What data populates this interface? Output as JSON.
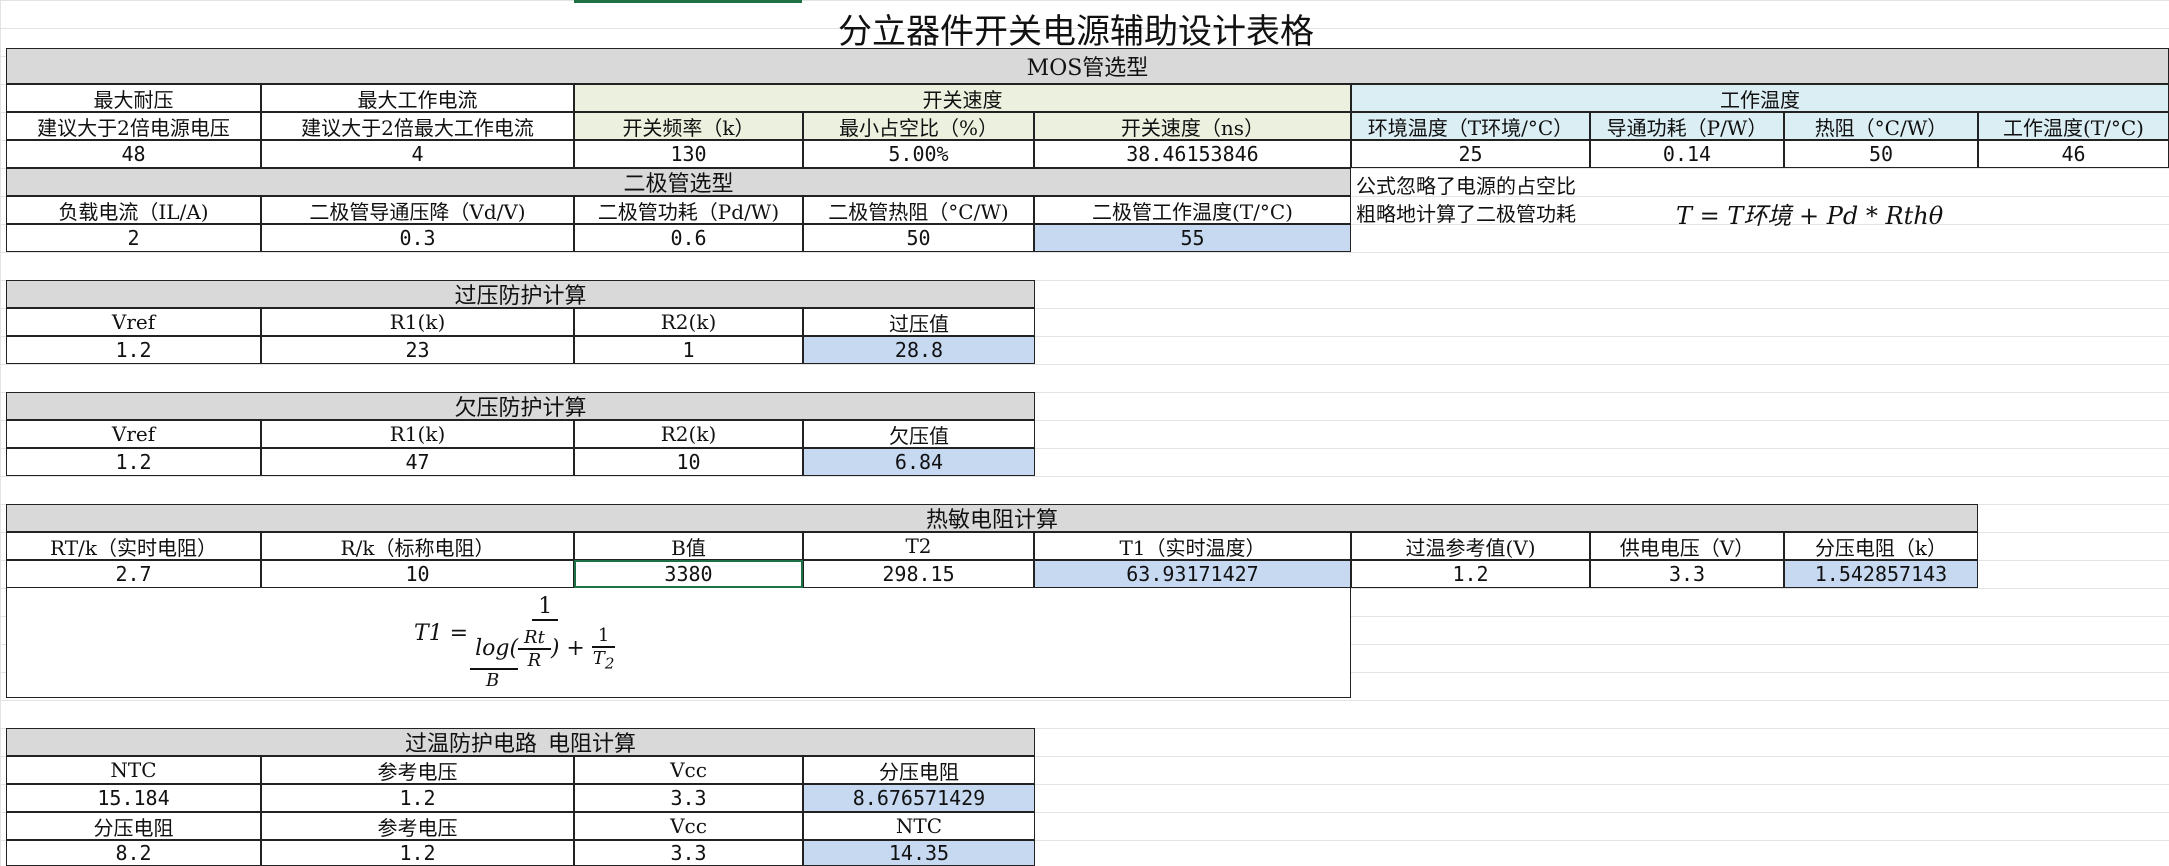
{
  "title": "分立器件开关电源辅助设计表格",
  "mos": {
    "section": "MOS管选型",
    "max_voltage": "最大耐压",
    "max_current": "最大工作电流",
    "switch_speed": "开关速度",
    "work_temp": "工作温度",
    "h_voltage": "建议大于2倍电源电压",
    "h_current": "建议大于2倍最大工作电流",
    "h_freq": "开关频率（k）",
    "h_duty": "最小占空比（%）",
    "h_speed": "开关速度（ns）",
    "h_env": "环境温度（T环境/°C）",
    "h_power": "导通功耗（P/W）",
    "h_thermal": "热阻（°C/W）",
    "h_wtemp": "工作温度(T/°C)",
    "values": [
      "48",
      "4",
      "130",
      "5.00%",
      "38.46153846",
      "25",
      "0.14",
      "50",
      "46"
    ]
  },
  "diode": {
    "section": "二极管选型",
    "headers": [
      "负载电流（IL/A)",
      "二极管导通压降（Vd/V)",
      "二极管功耗（Pd/W)",
      "二极管热阻（°C/W)",
      "二极管工作温度(T/°C)"
    ],
    "values": [
      "2",
      "0.3",
      "0.6",
      "50",
      "55"
    ],
    "note1": "公式忽略了电源的占空比",
    "note2": "粗略地计算了二极管功耗",
    "formula": "T = T环境 + Pd * Rthθ"
  },
  "ovp": {
    "section": "过压防护计算",
    "headers": [
      "Vref",
      "R1(k)",
      "R2(k)",
      "过压值"
    ],
    "values": [
      "1.2",
      "23",
      "1",
      "28.8"
    ]
  },
  "uvp": {
    "section": "欠压防护计算",
    "headers": [
      "Vref",
      "R1(k)",
      "R2(k)",
      "欠压值"
    ],
    "values": [
      "1.2",
      "47",
      "10",
      "6.84"
    ]
  },
  "ntc": {
    "section": "热敏电阻计算",
    "headers": [
      "RT/k（实时电阻）",
      "R/k（标称电阻）",
      "B值",
      "T2",
      "T1（实时温度）",
      "过温参考值(V)",
      "供电电压（V）",
      "分压电阻（k）"
    ],
    "values": [
      "2.7",
      "10",
      "3380",
      "298.15",
      "63.93171427",
      "1.2",
      "3.3",
      "1.542857143"
    ]
  },
  "otp": {
    "section": "过温防护电路_电阻计算",
    "headers1": [
      "NTC",
      "参考电压",
      "Vcc",
      "分压电阻"
    ],
    "values1": [
      "15.184",
      "1.2",
      "3.3",
      "8.676571429"
    ],
    "headers2": [
      "分压电阻",
      "参考电压",
      "Vcc",
      "NTC"
    ],
    "values2": [
      "8.2",
      "1.2",
      "3.3",
      "14.35"
    ]
  },
  "colors": {
    "header_gray": "#d9d9d9",
    "switch_green": "#ebf1de",
    "temp_blue": "#dbeef4",
    "result_blue": "#c6d9f1",
    "selection": "#1e7145"
  }
}
